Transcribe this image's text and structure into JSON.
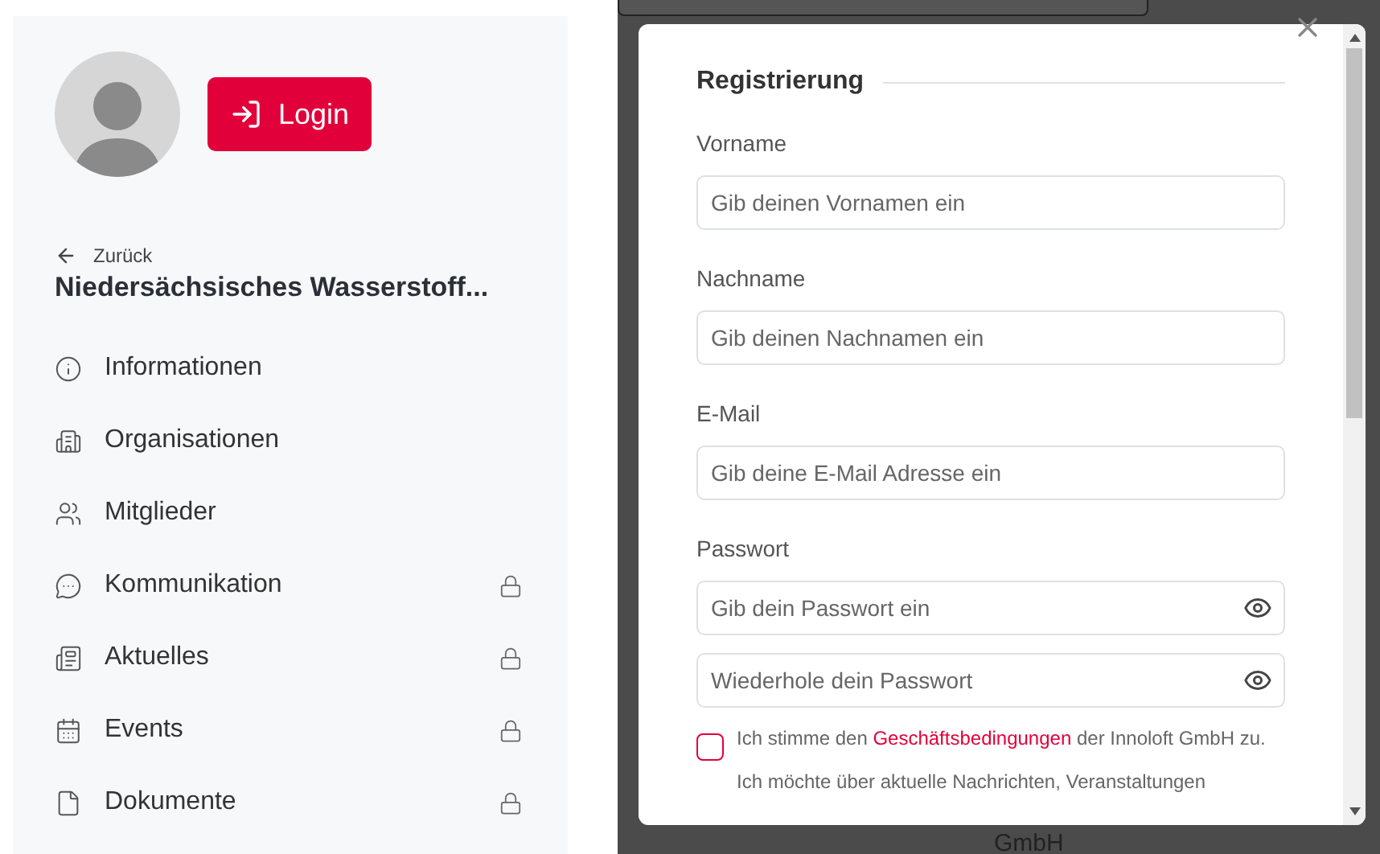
{
  "sidebar": {
    "login_button": "Login",
    "back_link": "Zurück",
    "title": "Niedersächsisches Wasserstoff...",
    "items": [
      {
        "label": "Informationen",
        "locked": false
      },
      {
        "label": "Organisationen",
        "locked": false
      },
      {
        "label": "Mitglieder",
        "locked": false
      },
      {
        "label": "Kommunikation",
        "locked": true
      },
      {
        "label": "Aktuelles",
        "locked": true
      },
      {
        "label": "Events",
        "locked": true
      },
      {
        "label": "Dokumente",
        "locked": true
      }
    ]
  },
  "background": {
    "footer_text": "GmbH"
  },
  "modal": {
    "title": "Registrierung",
    "fields": [
      {
        "label": "Vorname",
        "placeholder": "Gib deinen Vornamen ein",
        "kind": "text"
      },
      {
        "label": "Nachname",
        "placeholder": "Gib deinen Nachnamen ein",
        "kind": "text"
      },
      {
        "label": "E-Mail",
        "placeholder": "Gib deine E-Mail Adresse ein",
        "kind": "text"
      },
      {
        "label": "Passwort",
        "placeholder": "Gib dein Passwort ein",
        "kind": "password"
      },
      {
        "placeholder": "Wiederhole dein Passwort",
        "kind": "password"
      }
    ],
    "terms": {
      "checked": false,
      "before": "Ich stimme den ",
      "link": "Geschäftsbedingungen",
      "after": " der Innoloft GmbH zu."
    },
    "newsletter_text": "Ich möchte über aktuelle Nachrichten, Veranstaltungen"
  }
}
